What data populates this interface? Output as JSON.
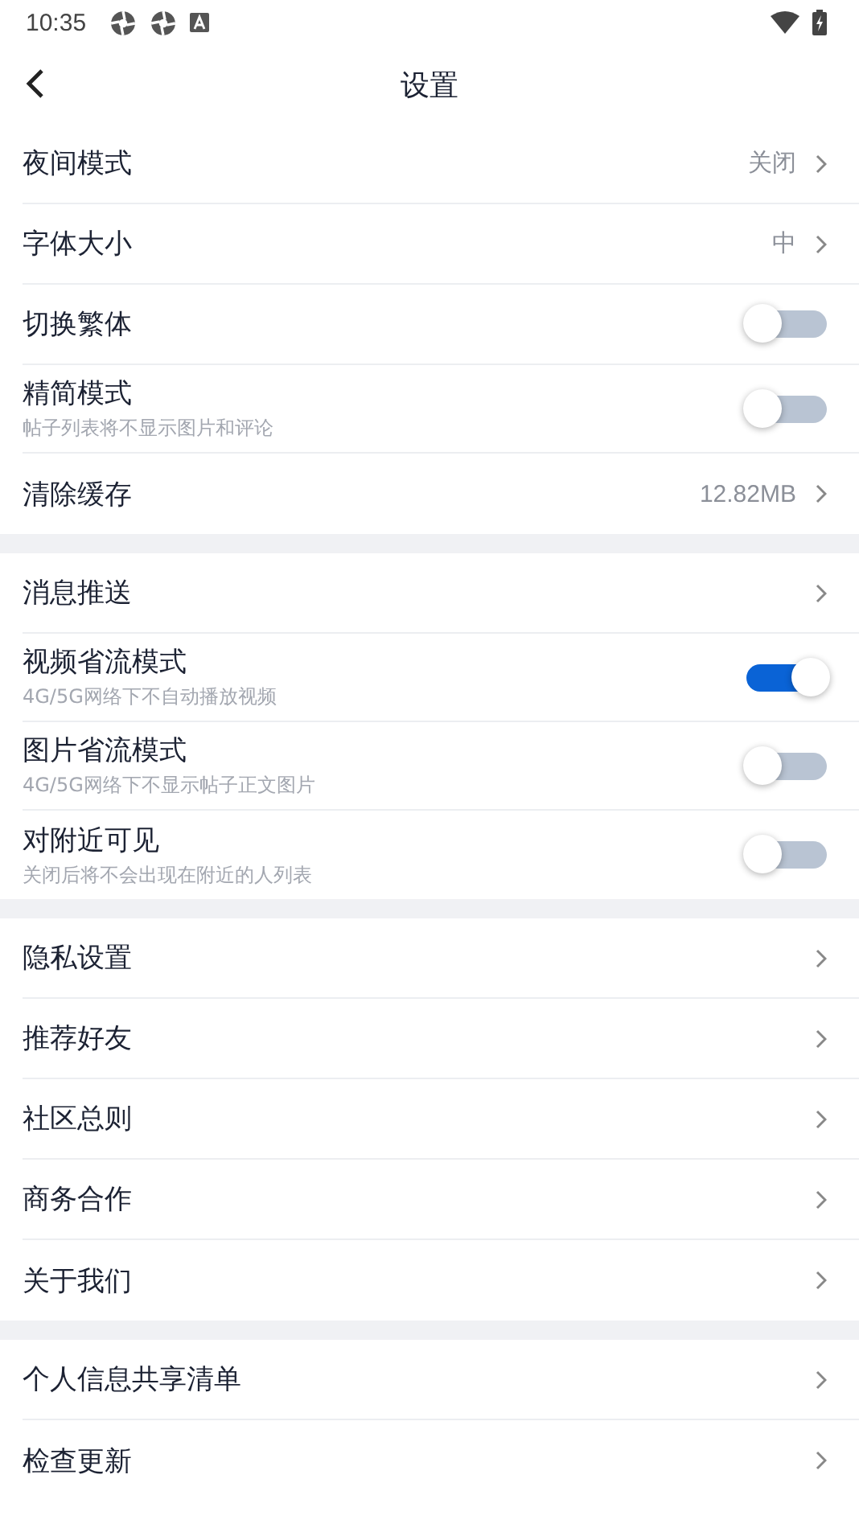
{
  "status_bar": {
    "time": "10:35"
  },
  "header": {
    "title": "设置"
  },
  "sections": [
    {
      "rows": [
        {
          "kind": "link",
          "label": "夜间模式",
          "value": "关闭"
        },
        {
          "kind": "link",
          "label": "字体大小",
          "value": "中"
        },
        {
          "kind": "toggle",
          "label": "切换繁体",
          "on": false
        },
        {
          "kind": "toggle",
          "label": "精简模式",
          "subtitle": "帖子列表将不显示图片和评论",
          "on": false
        },
        {
          "kind": "link",
          "label": "清除缓存",
          "value": "12.82MB"
        }
      ]
    },
    {
      "rows": [
        {
          "kind": "link",
          "label": "消息推送"
        },
        {
          "kind": "toggle",
          "label": "视频省流模式",
          "subtitle": "4G/5G网络下不自动播放视频",
          "on": true
        },
        {
          "kind": "toggle",
          "label": "图片省流模式",
          "subtitle": "4G/5G网络下不显示帖子正文图片",
          "on": false
        },
        {
          "kind": "toggle",
          "label": "对附近可见",
          "subtitle": "关闭后将不会出现在附近的人列表",
          "on": false
        }
      ]
    },
    {
      "rows": [
        {
          "kind": "link",
          "label": "隐私设置"
        },
        {
          "kind": "link",
          "label": "推荐好友"
        },
        {
          "kind": "link",
          "label": "社区总则"
        },
        {
          "kind": "link",
          "label": "商务合作"
        },
        {
          "kind": "link",
          "label": "关于我们"
        }
      ]
    },
    {
      "rows": [
        {
          "kind": "link",
          "label": "个人信息共享清单"
        },
        {
          "kind": "link",
          "label": "检查更新"
        }
      ]
    }
  ]
}
